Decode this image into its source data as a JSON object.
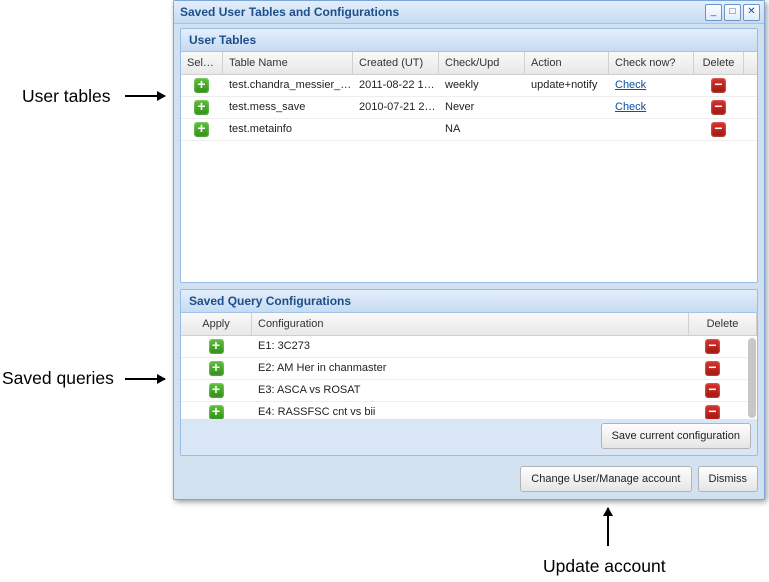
{
  "dialog": {
    "title": "Saved User Tables and Configurations",
    "win_minimize": "_",
    "win_maximize": "□",
    "win_close": "✕"
  },
  "user_tables": {
    "header": "User Tables",
    "cols": {
      "select": "Select",
      "table_name": "Table Name",
      "created": "Created (UT)",
      "check_upd": "Check/Upd",
      "action": "Action",
      "check_now": "Check now?",
      "delete": "Delete"
    },
    "rows": [
      {
        "table_name": "test.chandra_messier_…",
        "created": "2011-08-22 1…",
        "check_upd": "weekly",
        "action": "update+notify",
        "check_now": "Check",
        "deletable": true
      },
      {
        "table_name": "test.mess_save",
        "created": "2010-07-21 2…",
        "check_upd": "Never",
        "action": "",
        "check_now": "Check",
        "deletable": true
      },
      {
        "table_name": "test.metainfo",
        "created": "",
        "check_upd": "NA",
        "action": "",
        "check_now": "",
        "deletable": true
      }
    ]
  },
  "saved_queries": {
    "header": "Saved Query Configurations",
    "cols": {
      "apply": "Apply",
      "configuration": "Configuration",
      "delete": "Delete"
    },
    "rows": [
      {
        "configuration": "E1: 3C273"
      },
      {
        "configuration": "E2: AM Her in chanmaster"
      },
      {
        "configuration": "E3: ASCA vs ROSAT"
      },
      {
        "configuration": "E4: RASSFSC cnt vs bii"
      }
    ],
    "save_button": "Save current configuration"
  },
  "buttons": {
    "change_user": "Change User/Manage account",
    "dismiss": "Dismiss"
  },
  "annotations": {
    "user_tables": "User  tables",
    "saved_queries": "Saved queries",
    "update_account": "Update account"
  },
  "icons": {
    "add": "+",
    "del": "−"
  }
}
